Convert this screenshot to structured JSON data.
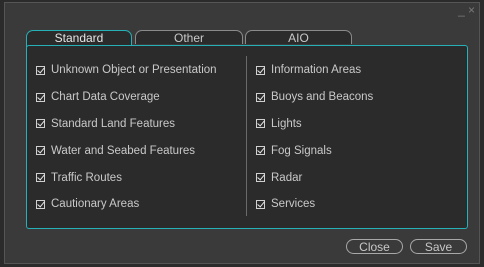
{
  "window": {
    "controls": [
      "_",
      "×"
    ]
  },
  "tabs": [
    {
      "label": "Standard",
      "active": true
    },
    {
      "label": "Other",
      "active": false
    },
    {
      "label": "AIO",
      "active": false
    }
  ],
  "left_items": [
    {
      "label": "Unknown Object or Presentation",
      "checked": true
    },
    {
      "label": "Chart Data Coverage",
      "checked": true
    },
    {
      "label": "Standard Land Features",
      "checked": true
    },
    {
      "label": "Water and Seabed Features",
      "checked": true
    },
    {
      "label": "Traffic Routes",
      "checked": true
    },
    {
      "label": "Cautionary Areas",
      "checked": true
    }
  ],
  "right_items": [
    {
      "label": "Information Areas",
      "checked": true
    },
    {
      "label": "Buoys and Beacons",
      "checked": true
    },
    {
      "label": "Lights",
      "checked": true
    },
    {
      "label": "Fog Signals",
      "checked": true
    },
    {
      "label": "Radar",
      "checked": true
    },
    {
      "label": "Services",
      "checked": true
    }
  ],
  "buttons": {
    "close": "Close",
    "save": "Save"
  },
  "colors": {
    "accent": "#26b0b8",
    "background": "#2b2b2b",
    "text": "#c9c9c9"
  }
}
